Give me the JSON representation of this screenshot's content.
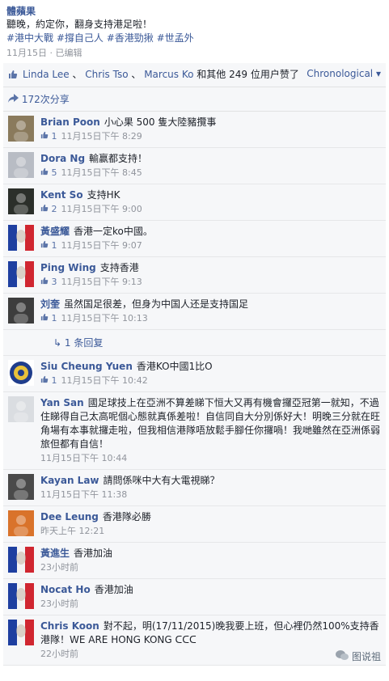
{
  "post": {
    "author": "體蘋果",
    "text": "聽晚，約定你，翻身支持港足啦！",
    "hashtags": "#港中大戰 #撐自己人 #香港勁揪 #世孟外",
    "time": "11月15日",
    "edited": "已编辑"
  },
  "likes": {
    "name1": "Linda Lee",
    "name2": "Chris Tso",
    "name3": "Marcus Ko",
    "rest": "和其他 249 位用户赞了",
    "order": "Chronological"
  },
  "shares": {
    "label": "172次分享"
  },
  "comments": [
    {
      "name": "Brian Poon",
      "text": "小心果 500 隻大陸豬攬事",
      "likes": "1",
      "time": "11月15日下午 8:29",
      "avatar_color": "#8a7a5c"
    },
    {
      "name": "Dora Ng",
      "text": "輸赢都支持！",
      "likes": "5",
      "time": "11月15日下午 8:45",
      "avatar_color": "#b8bcc4"
    },
    {
      "name": "Kent So",
      "text": "支持HK",
      "likes": "2",
      "time": "11月15日下午 9:00",
      "avatar_color": "#2b2f2a"
    },
    {
      "name": "黃盛耀",
      "text": "香港一定ko中國。",
      "likes": "1",
      "time": "11月15日下午 9:07",
      "avatar_color": "flag"
    },
    {
      "name": "Ping Wing",
      "text": "支持香港",
      "likes": "3",
      "time": "11月15日下午 9:13",
      "avatar_color": "flag"
    },
    {
      "name": "刘奎",
      "text": "虽然国足很差，但身为中国人还是支持国足",
      "likes": "1",
      "time": "11月15日下午 10:13",
      "avatar_color": "#3d3d3d"
    },
    {
      "name": "Siu Cheung Yuen",
      "text": "香港KO中國1比O",
      "likes": "1",
      "time": "11月15日下午 10:42",
      "avatar_color": "badge"
    },
    {
      "name": "Yan San",
      "text": "國足球技上在亞洲不算差睇下恒大又再有機會攞亞冠第一就知，不過住睇得自己太高呢個心態就真係差啦！自信同自大分別係好大！明晚三分就在旺角場有本事就攞走啦，但我相信港隊唔放鬆手腳任你攞喎！我哋雖然在亞洲係弱旅但都有自信！",
      "likes": "",
      "time": "11月15日下午 10:44",
      "avatar_color": "#dadde1"
    },
    {
      "name": "Kayan Law",
      "text": "請問係咪中大有大電視睇？",
      "likes": "",
      "time": "11月15日下午 11:38",
      "avatar_color": "#4a4a4a"
    },
    {
      "name": "Dee Leung",
      "text": "香港隊必勝",
      "likes": "",
      "time": "昨天上午 12:21",
      "avatar_color": "#d9732b"
    },
    {
      "name": "黃進生",
      "text": "香港加油",
      "likes": "",
      "time": "23小时前",
      "avatar_color": "flag"
    },
    {
      "name": "Nocat Ho",
      "text": "香港加油",
      "likes": "",
      "time": "23小时前",
      "avatar_color": "flag"
    },
    {
      "name": "Chris Koon",
      "text": "對不起，明(17/11/2015)晚我要上班，但心裡仍然100%支持香港隊！WE ARE HONG KONG ᑕᑕᑕ",
      "likes": "",
      "time": "22小时前",
      "avatar_color": "flag"
    }
  ],
  "reply": {
    "label": "1 条回复"
  },
  "watermark": "图说祖"
}
